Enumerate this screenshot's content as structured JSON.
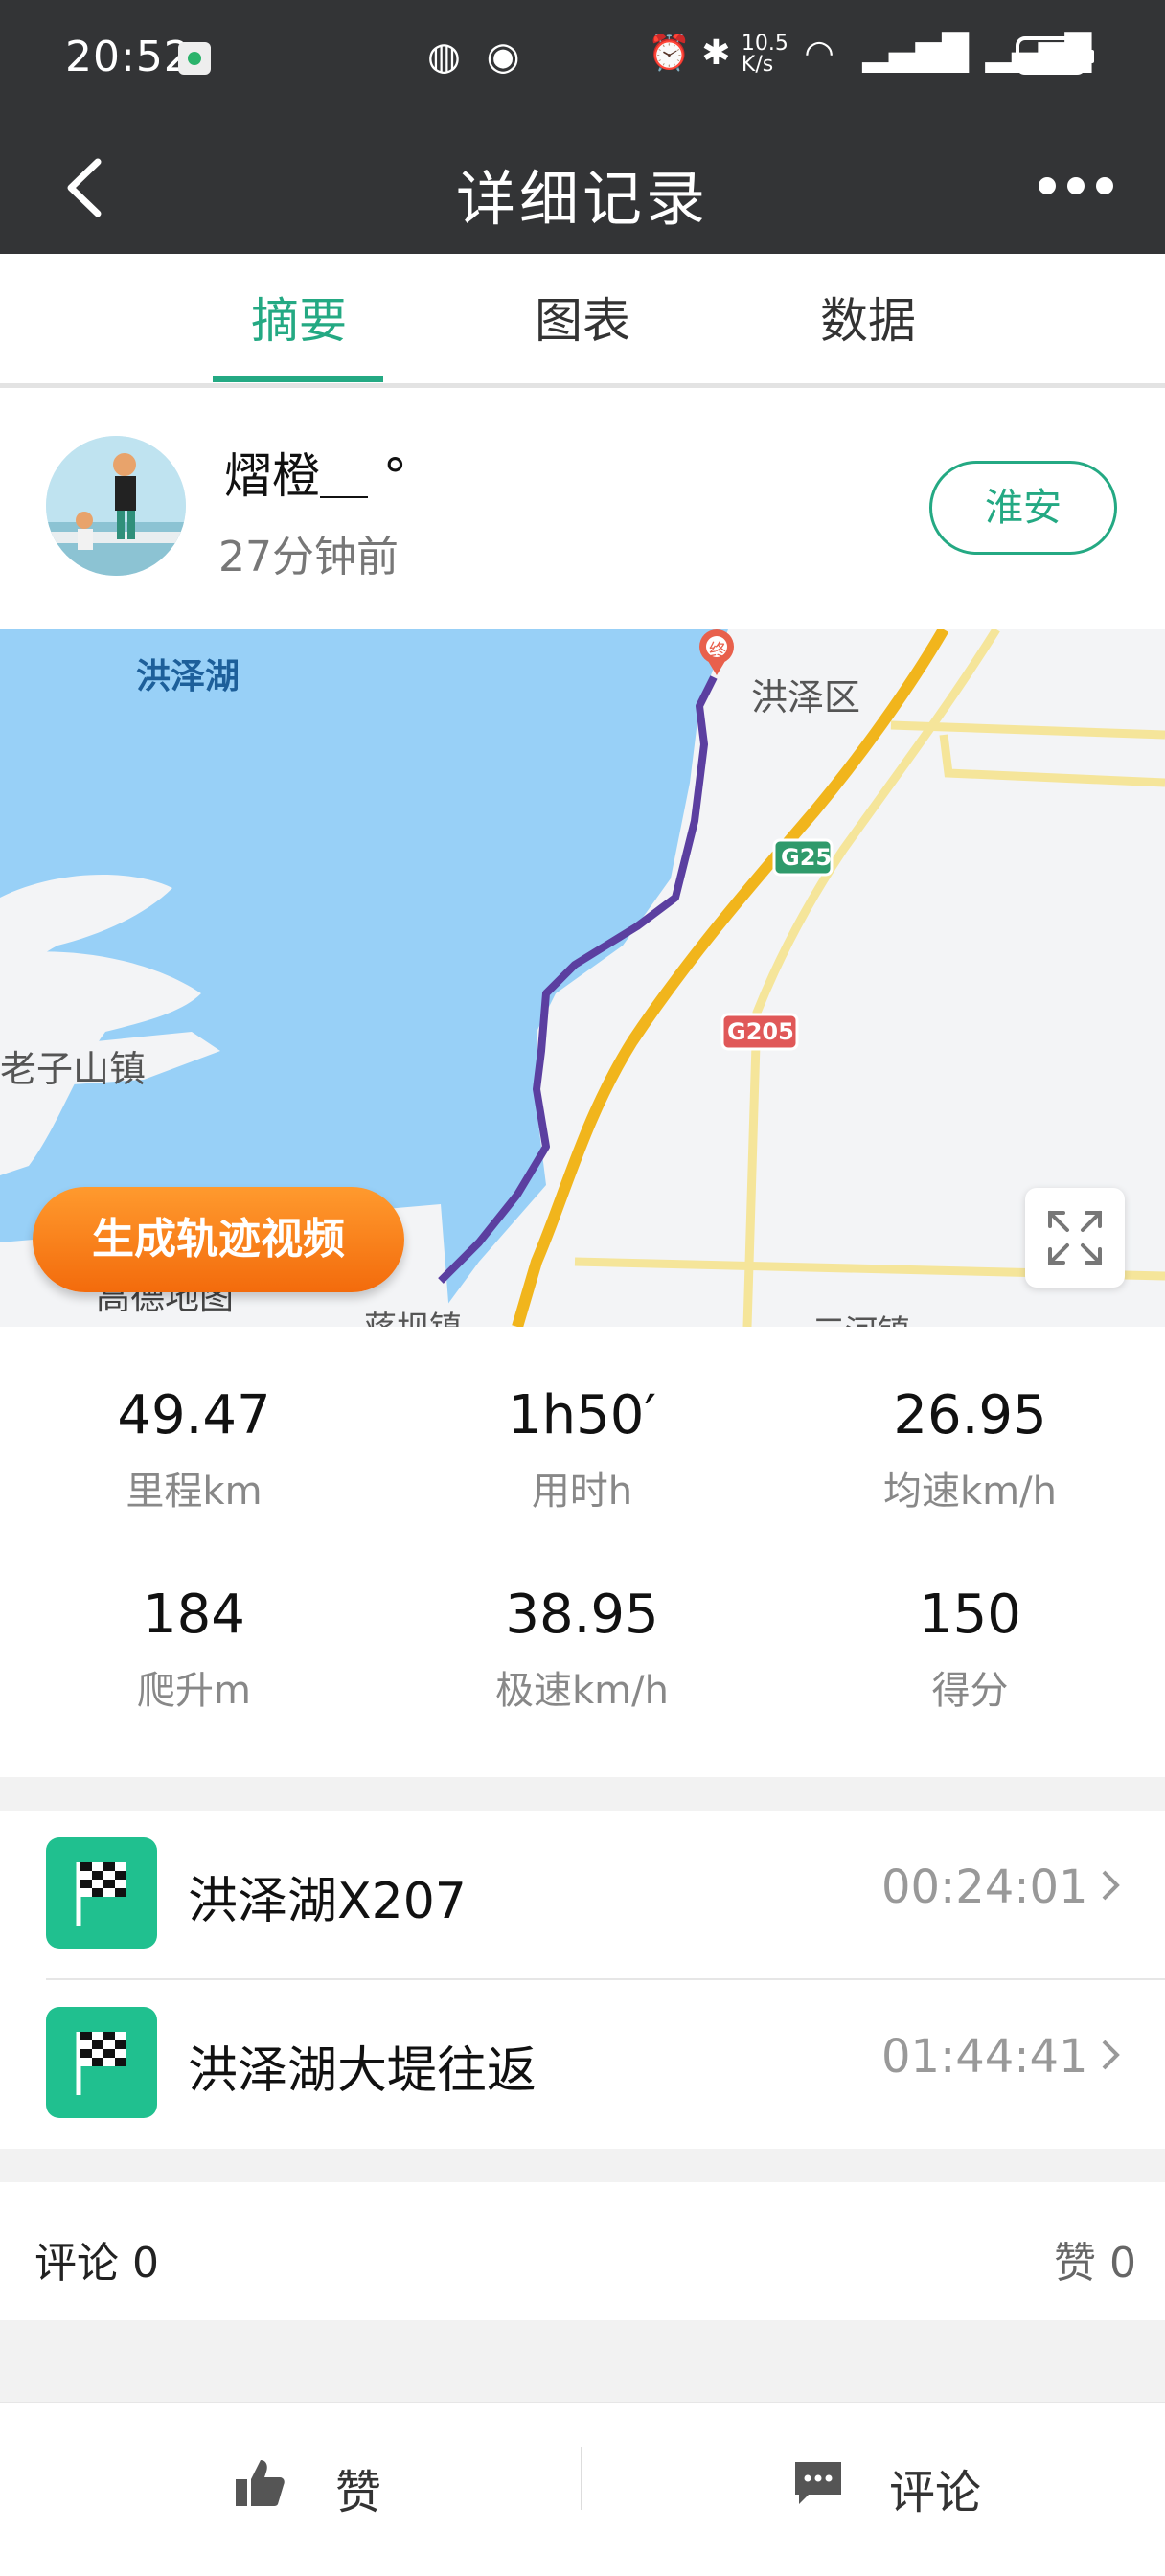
{
  "status_bar": {
    "time": "20:52",
    "net_speed": "10.5 K/s",
    "battery": "40"
  },
  "header": {
    "title": "详细记录"
  },
  "tabs": [
    {
      "label": "摘要",
      "active": true
    },
    {
      "label": "图表",
      "active": false
    },
    {
      "label": "数据",
      "active": false
    }
  ],
  "user": {
    "name": "熠橙＿ °",
    "time_ago": "27分钟前",
    "location_button": "淮安"
  },
  "map": {
    "labels": {
      "lake": "洪泽湖",
      "district": "洪泽区",
      "town_left": "老子山镇",
      "town_bottom_left": "蒋坝镇",
      "town_bottom_right": "三河镇",
      "road_g25": "G25",
      "road_g205": "G205",
      "end_marker": "终",
      "logo": "高德地图"
    },
    "generate_video_button": "生成轨迹视频"
  },
  "stats": [
    {
      "value": "49.47",
      "label": "里程km"
    },
    {
      "value": "1h50′",
      "label": "用时h"
    },
    {
      "value": "26.95",
      "label": "均速km/h"
    },
    {
      "value": "184",
      "label": "爬升m"
    },
    {
      "value": "38.95",
      "label": "极速km/h"
    },
    {
      "value": "150",
      "label": "得分"
    }
  ],
  "segments": [
    {
      "name": "洪泽湖X207",
      "duration": "00:24:01"
    },
    {
      "name": "洪泽湖大堤往返",
      "duration": "01:44:41"
    }
  ],
  "comments": {
    "comments_label": "评论 0",
    "likes_label": "赞 0"
  },
  "bottom_bar": {
    "like_label": "赞",
    "comment_label": "评论"
  },
  "colors": {
    "accent": "#24a983",
    "header_bg": "#333436",
    "route": "#5b3fa0",
    "orange_button": "#f57c12"
  }
}
